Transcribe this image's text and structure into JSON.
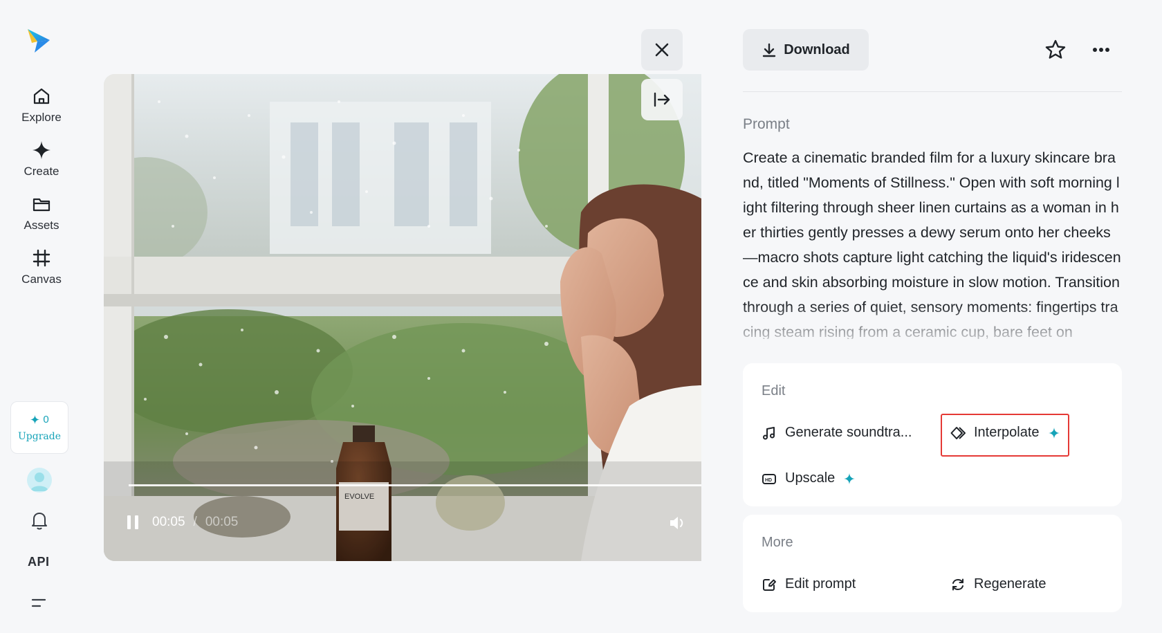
{
  "colors": {
    "accent": "#16a3b8",
    "highlight": "#e53935",
    "background": "#f6f7f9"
  },
  "sidebar": {
    "logo_icon": "paper-plane-logo-icon",
    "items": [
      {
        "label": "Explore",
        "icon": "home-icon"
      },
      {
        "label": "Create",
        "icon": "diamond-icon"
      },
      {
        "label": "Assets",
        "icon": "folder-icon"
      },
      {
        "label": "Canvas",
        "icon": "canvas-crop-icon"
      }
    ],
    "upgrade": {
      "credits": "0",
      "label": "Upgrade"
    },
    "api_label": "API"
  },
  "video": {
    "current_time": "00:05",
    "separator": "/",
    "total_time": "00:05",
    "progress": 1.0,
    "product_label": "EVOLVE"
  },
  "toolbar": {
    "download_label": "Download"
  },
  "prompt": {
    "heading": "Prompt",
    "text": "Create a cinematic branded film for a luxury skincare brand, titled \"Moments of Stillness.\" Open with soft morning light filtering through sheer linen curtains as a woman in her thirties gently presses a dewy serum onto her cheeks—macro shots capture light catching the liquid's iridescence and skin absorbing moisture in slow motion. Transition through a series of quiet, sensory moments: fingertips tracing steam rising from a ceramic cup, bare feet on"
  },
  "edit": {
    "title": "Edit",
    "actions": [
      {
        "label": "Generate soundtra...",
        "icon": "music-note-icon"
      },
      {
        "label": "Interpolate",
        "icon": "interpolate-icon",
        "premium": true
      },
      {
        "label": "Upscale",
        "icon": "hd-icon",
        "premium": true
      }
    ]
  },
  "more": {
    "title": "More",
    "actions": [
      {
        "label": "Edit prompt",
        "icon": "edit-prompt-icon"
      },
      {
        "label": "Regenerate",
        "icon": "regenerate-icon"
      }
    ]
  }
}
